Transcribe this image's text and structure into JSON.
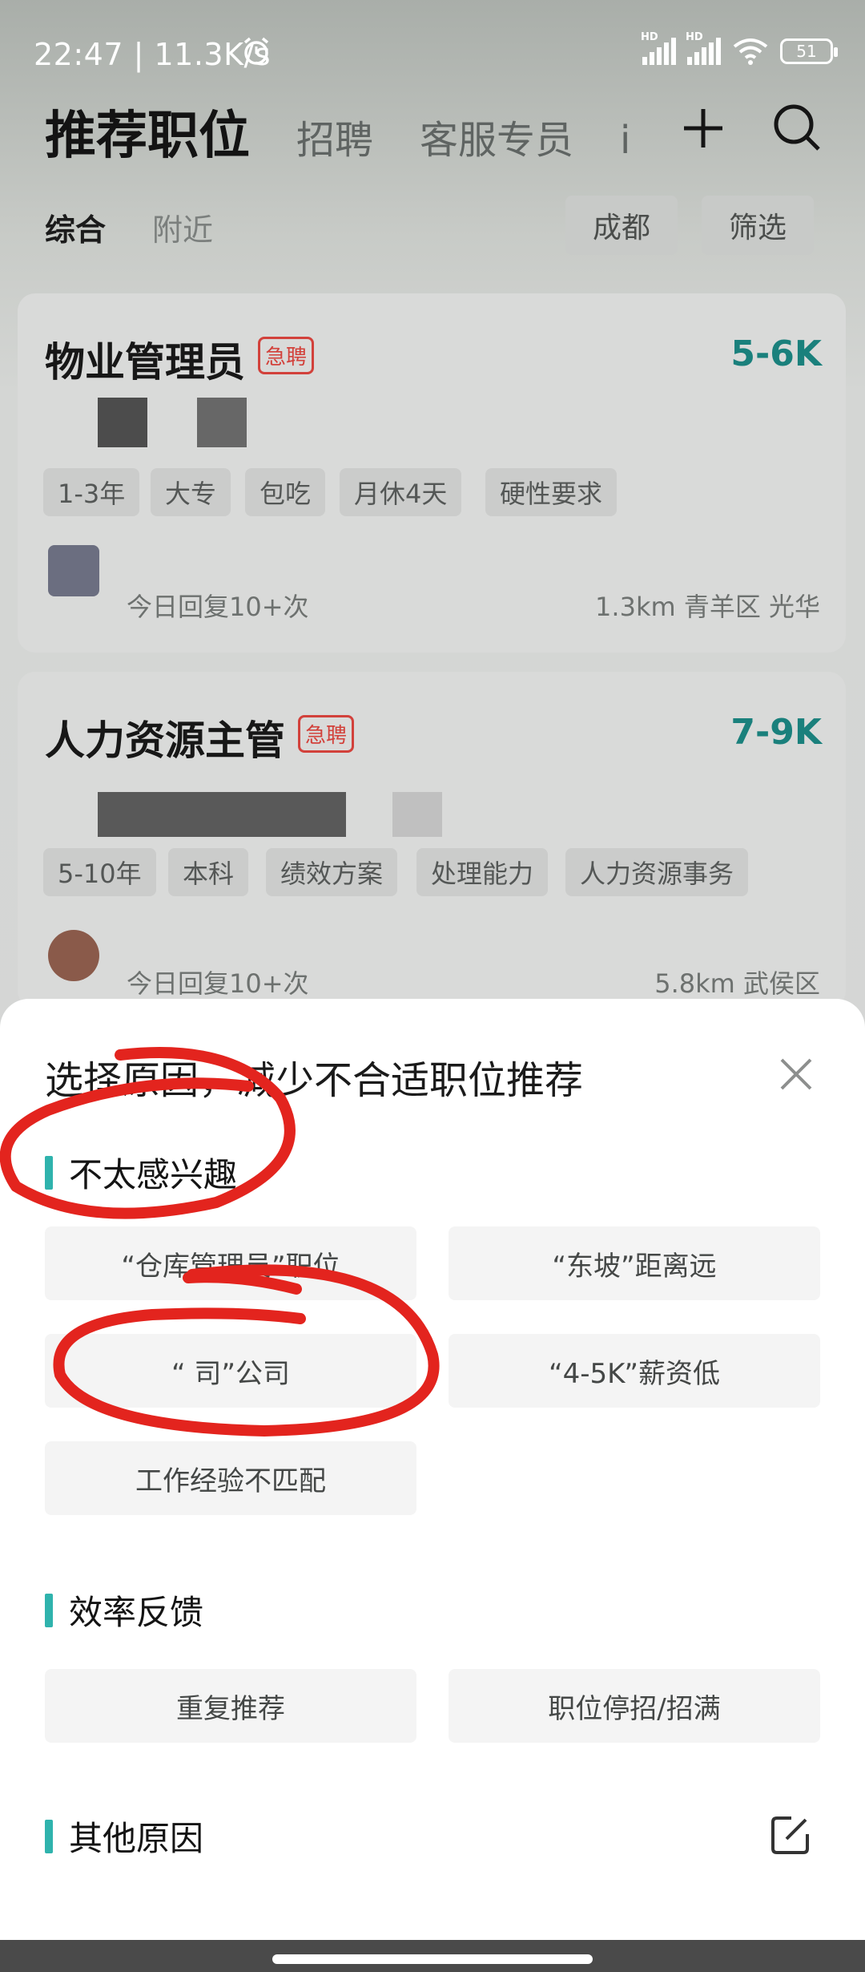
{
  "status_bar": {
    "time": "22:47 | 11.3K/s",
    "battery": "51"
  },
  "top_tabs": {
    "active": "推荐职位",
    "others": [
      "招聘",
      "客服专员",
      "i"
    ]
  },
  "filters": {
    "active": "综合",
    "nearby": "附近",
    "city": "成都",
    "filter": "筛选"
  },
  "jobs": [
    {
      "title": "物业管理员",
      "badge": "急聘",
      "salary": "5-6K",
      "tags": [
        "1-3年",
        "大专",
        "包吃",
        "月休4天",
        "硬性要求"
      ],
      "reply": "今日回复10+次",
      "location": "1.3km  青羊区  光华"
    },
    {
      "title": "人力资源主管",
      "badge": "急聘",
      "salary": "7-9K",
      "tags": [
        "5-10年",
        "本科",
        "绩效方案",
        "处理能力",
        "人力资源事务"
      ],
      "reply": "今日回复10+次",
      "location": "5.8km  武侯区"
    }
  ],
  "sheet": {
    "title": "选择原因，减少不合适职位推荐",
    "sections": [
      {
        "title": "不太感兴趣",
        "options": [
          "“仓库管理员”职位",
          "“东坡”距离远",
          "“         司”公司",
          "“4-5K”薪资低",
          "工作经验不匹配"
        ]
      },
      {
        "title": "效率反馈",
        "options": [
          "重复推荐",
          "职位停招/招满"
        ]
      },
      {
        "title": "其他原因",
        "options": []
      }
    ]
  },
  "colors": {
    "accent": "#2fb3ad",
    "salary": "#1a807c",
    "urgent": "#d2413b",
    "annotation": "#e3241e"
  }
}
